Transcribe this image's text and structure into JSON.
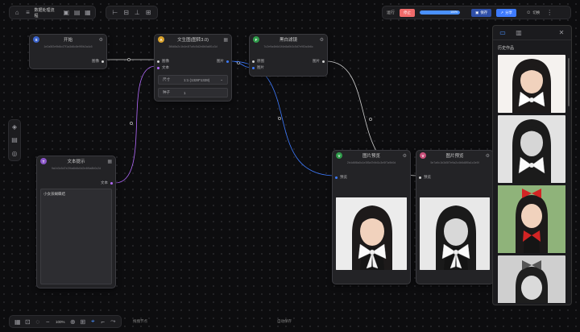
{
  "toolbar": {
    "project_name": "数据处理流程",
    "home_icon": "home-icon",
    "menu_icon": "menu-icon"
  },
  "header_right": {
    "run_label": "运行",
    "run_state": "停止",
    "progress_label": "100%",
    "progress_value": 1.0,
    "save_label": "保存",
    "share_label": "分享",
    "user_label": "切换"
  },
  "nodes": {
    "start": {
      "badge": "S",
      "title": "开始",
      "id": "1e2a5f2e9b8c47f1a3d6c8e9f0b2a4c5",
      "out_label": "图像"
    },
    "t2i": {
      "badge": "A",
      "title": "文生图(图转3.0)",
      "id": "3f6d8a2c1b4e4f7a9c5d2e8b0a6f1c3d",
      "in1": "图像",
      "in2": "文本",
      "out": "图片",
      "size_label": "尺寸",
      "size_value": "1:1 (1328*1328)",
      "seed_label": "种子",
      "seed_value": "1"
    },
    "bw": {
      "badge": "F",
      "title": "黑白滤镜",
      "id": "7c2e9a4b6d1f4e8a0b3c5d7e9f2a4b6c",
      "in1": "原图",
      "in2": "图片",
      "out": "图片"
    },
    "text": {
      "badge": "T",
      "title": "文本提示",
      "id": "9a1b3c5d7e2f4a6b8c0d2e4f6a8b0c2d",
      "out": "文本",
      "prompt": "小女孩蝴蝶结"
    },
    "pv1": {
      "badge": "V",
      "title": "图片预览",
      "id": "2b4d6f8a0c1e3f5a7b9d1c3e5f7a9b0d",
      "in": "预览"
    },
    "pv2": {
      "badge": "V",
      "title": "图片预览",
      "id": "5e7a9c1b3d5f7e9a2c4b6d8f0a1c3e5f",
      "in": "预览"
    }
  },
  "panel": {
    "title": "历史作品",
    "tab1_icon": "image-icon",
    "tab2_icon": "library-icon",
    "close_icon": "close-icon"
  },
  "bottom": {
    "zoom": "100%",
    "hint": "拖拽节点",
    "status": "自动保存"
  }
}
